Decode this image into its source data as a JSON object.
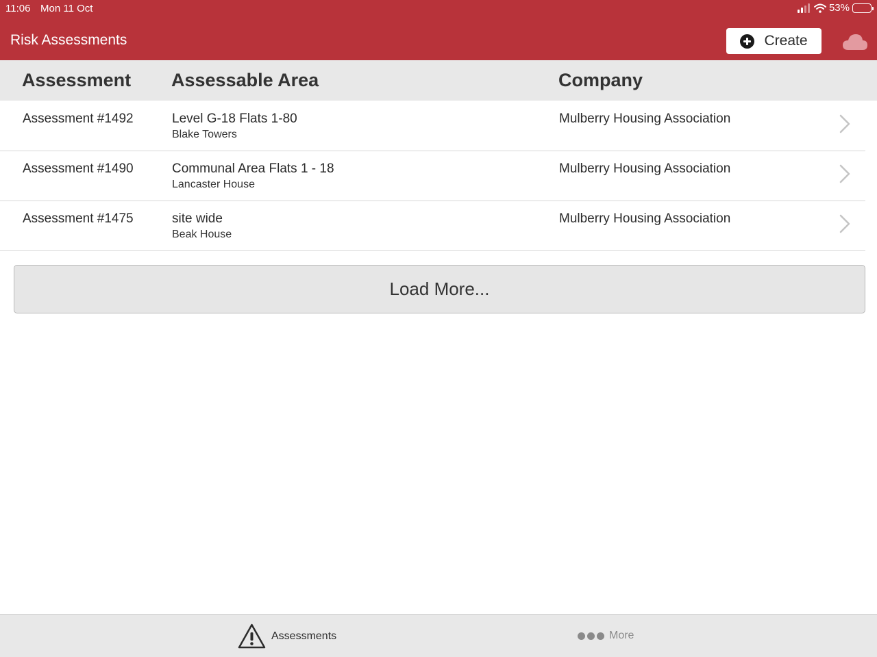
{
  "status_bar": {
    "time": "11:06",
    "date": "Mon 11 Oct",
    "battery_percent": "53%",
    "battery_level": 0.53
  },
  "header": {
    "title": "Risk Assessments",
    "create_label": "Create"
  },
  "columns": {
    "assessment": "Assessment",
    "area": "Assessable Area",
    "company": "Company"
  },
  "rows": [
    {
      "id": "Assessment #1492",
      "area": "Level G-18 Flats 1-80",
      "building": "Blake Towers",
      "company": "Mulberry Housing Association"
    },
    {
      "id": "Assessment #1490",
      "area": "Communal Area Flats 1 - 18",
      "building": "Lancaster House",
      "company": "Mulberry Housing Association"
    },
    {
      "id": "Assessment #1475",
      "area": "site wide",
      "building": "Beak House",
      "company": "Mulberry Housing Association"
    }
  ],
  "load_more_label": "Load More...",
  "tabs": {
    "assessments_label": "Assessments",
    "more_label": "More"
  },
  "colors": {
    "brand": "#b8333a",
    "header_bg": "#e8e8e8",
    "inactive_tab": "#8a8a8a"
  }
}
